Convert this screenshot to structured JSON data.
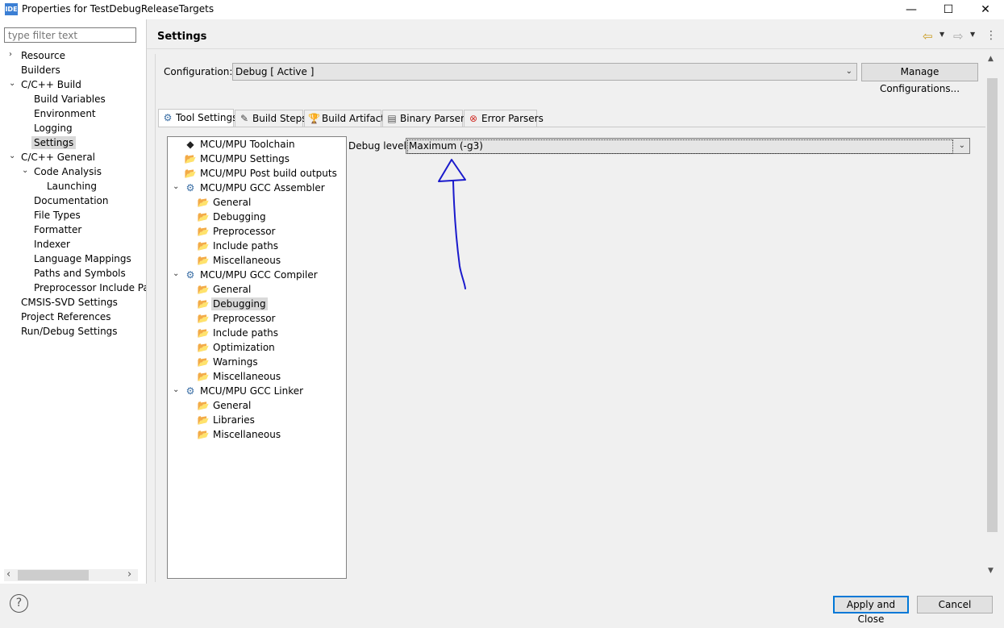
{
  "window": {
    "app_icon_text": "IDE",
    "title": "Properties for TestDebugReleaseTargets",
    "min": "—",
    "max": "☐",
    "close": "✕"
  },
  "left": {
    "filter_placeholder": "type filter text",
    "items": [
      {
        "label": "Resource",
        "caret": "›"
      },
      {
        "label": "Builders"
      },
      {
        "label": "C/C++ Build",
        "caret": "⌄"
      },
      {
        "label": "Build Variables"
      },
      {
        "label": "Environment"
      },
      {
        "label": "Logging"
      },
      {
        "label": "Settings"
      },
      {
        "label": "C/C++ General",
        "caret": "⌄"
      },
      {
        "label": "Code Analysis",
        "caret": "⌄"
      },
      {
        "label": "Launching"
      },
      {
        "label": "Documentation"
      },
      {
        "label": "File Types"
      },
      {
        "label": "Formatter"
      },
      {
        "label": "Indexer"
      },
      {
        "label": "Language Mappings"
      },
      {
        "label": "Paths and Symbols"
      },
      {
        "label": "Preprocessor Include Pat"
      },
      {
        "label": "CMSIS-SVD Settings"
      },
      {
        "label": "Project References"
      },
      {
        "label": "Run/Debug Settings"
      }
    ],
    "scroll_left": "‹",
    "scroll_right": "›"
  },
  "header": {
    "title": "Settings",
    "back_icon": "⇦",
    "forward_icon": "⇨",
    "menu_icon": "⋮"
  },
  "config": {
    "label": "Configuration:",
    "value": "Debug  [ Active ]",
    "manage": "Manage Configurations..."
  },
  "tabs": [
    {
      "label": "Tool Settings",
      "icon": "⚙"
    },
    {
      "label": "Build Steps",
      "icon": "✎"
    },
    {
      "label": "Build Artifact",
      "icon": "🏆"
    },
    {
      "label": "Binary Parsers",
      "icon": "▤"
    },
    {
      "label": "Error Parsers",
      "icon": "⊗"
    }
  ],
  "tree": [
    {
      "label": "MCU/MPU Toolchain"
    },
    {
      "label": "MCU/MPU Settings"
    },
    {
      "label": "MCU/MPU Post build outputs"
    },
    {
      "label": "MCU/MPU GCC Assembler",
      "caret": "⌄"
    },
    {
      "label": "General"
    },
    {
      "label": "Debugging"
    },
    {
      "label": "Preprocessor"
    },
    {
      "label": "Include paths"
    },
    {
      "label": "Miscellaneous"
    },
    {
      "label": "MCU/MPU GCC Compiler",
      "caret": "⌄"
    },
    {
      "label": "General"
    },
    {
      "label": "Debugging"
    },
    {
      "label": "Preprocessor"
    },
    {
      "label": "Include paths"
    },
    {
      "label": "Optimization"
    },
    {
      "label": "Warnings"
    },
    {
      "label": "Miscellaneous"
    },
    {
      "label": "MCU/MPU GCC Linker",
      "caret": "⌄"
    },
    {
      "label": "General"
    },
    {
      "label": "Libraries"
    },
    {
      "label": "Miscellaneous"
    }
  ],
  "debug_level": {
    "label": "Debug level",
    "value": "Maximum (-g3)"
  },
  "footer": {
    "help": "?",
    "apply": "Apply and Close",
    "cancel": "Cancel"
  },
  "colors": {
    "annotation": "#1a1acc",
    "accent": "#0078d7"
  }
}
